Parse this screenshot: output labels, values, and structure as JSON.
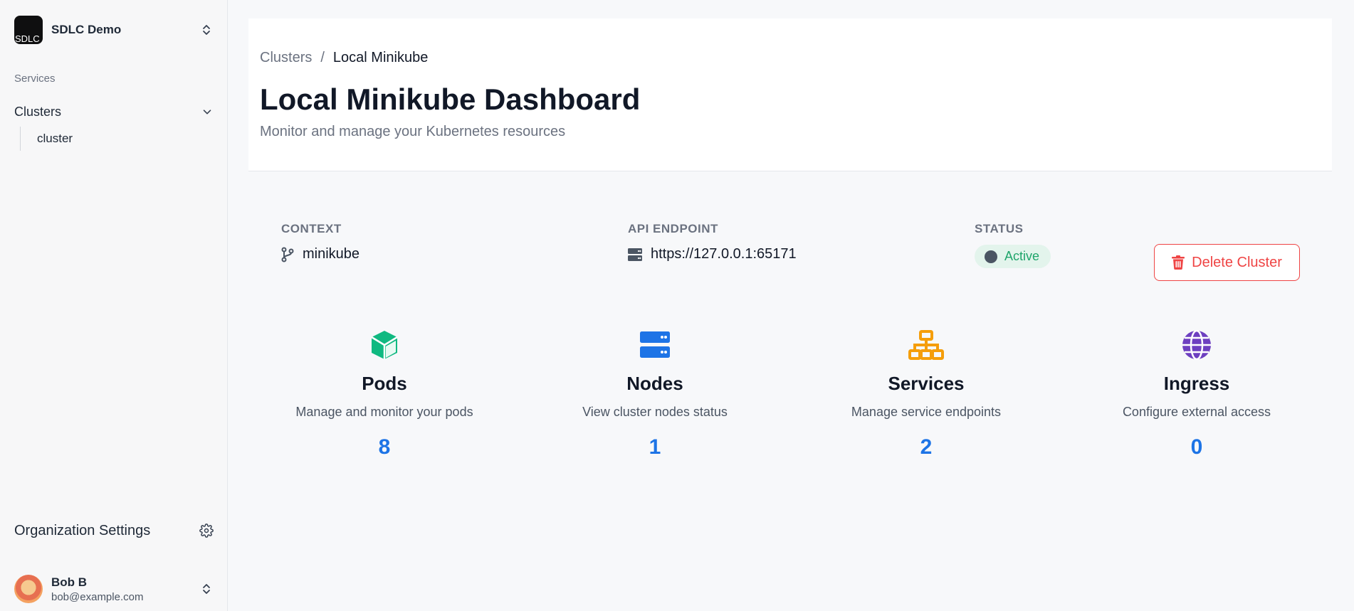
{
  "sidebar": {
    "org_name": "SDLC Demo",
    "org_logo_alt": "SDLC",
    "section_label": "Services",
    "nav_clusters_label": "Clusters",
    "nav_cluster_sub_label": "cluster",
    "org_settings_label": "Organization Settings",
    "user": {
      "name": "Bob B",
      "email": "bob@example.com"
    }
  },
  "header": {
    "breadcrumb": {
      "parent": "Clusters",
      "separator": "/",
      "current": "Local Minikube"
    },
    "title": "Local Minikube Dashboard",
    "subtitle": "Monitor and manage your Kubernetes resources"
  },
  "info": {
    "context_label": "CONTEXT",
    "context_value": "minikube",
    "endpoint_label": "API ENDPOINT",
    "endpoint_value": "https://127.0.0.1:65171",
    "status_label": "STATUS",
    "status_value": "Active",
    "delete_label": "Delete Cluster"
  },
  "stats": [
    {
      "title": "Pods",
      "description": "Manage and monitor your pods",
      "count": "8",
      "icon": "cube-icon",
      "color": "#10b981"
    },
    {
      "title": "Nodes",
      "description": "View cluster nodes status",
      "count": "1",
      "icon": "server-icon",
      "color": "#1d74e6"
    },
    {
      "title": "Services",
      "description": "Manage service endpoints",
      "count": "2",
      "icon": "network-icon",
      "color": "#f59e0b"
    },
    {
      "title": "Ingress",
      "description": "Configure external access",
      "count": "0",
      "icon": "globe-icon",
      "color": "#6d3fc0"
    }
  ],
  "colors": {
    "accent_blue": "#1d74e6",
    "danger": "#ef4444",
    "status_green": "#1fa56b"
  }
}
